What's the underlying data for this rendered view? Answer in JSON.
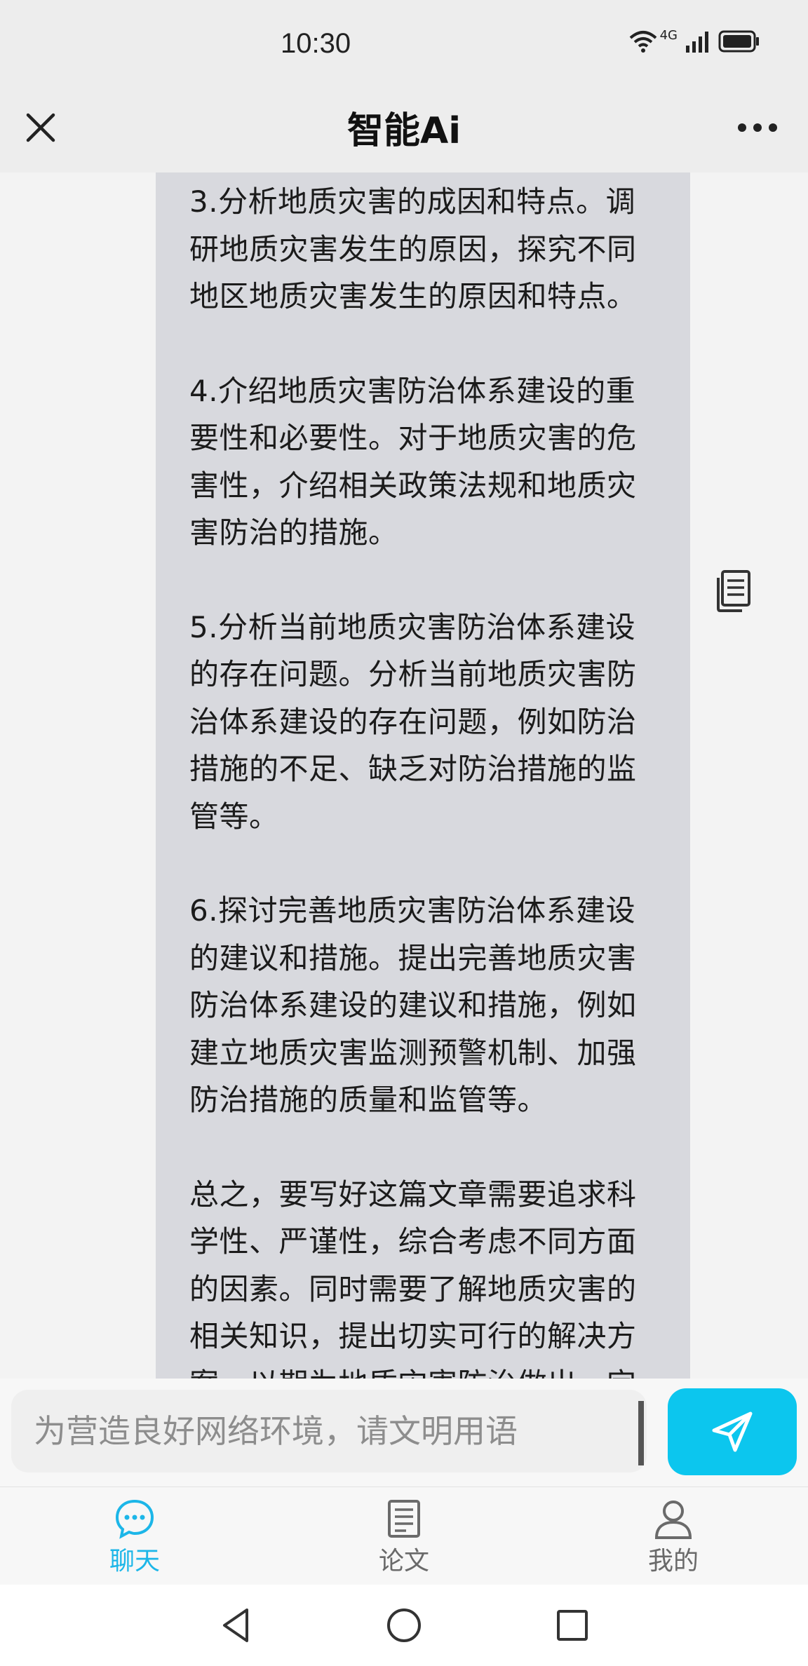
{
  "status_bar": {
    "time": "10:30",
    "network_label": "4G",
    "icons": [
      "wifi-icon",
      "signal-icon",
      "battery-icon"
    ]
  },
  "header": {
    "title": "智能Ai",
    "close_icon": "close-icon",
    "more_icon": "more-icon"
  },
  "chat": {
    "paragraphs": [
      "3.分析地质灾害的成因和特点。调研地质灾害发生的原因，探究不同地区地质灾害发生的原因和特点。",
      "4.介绍地质灾害防治体系建设的重要性和必要性。对于地质灾害的危害性，介绍相关政策法规和地质灾害防治的措施。",
      "5.分析当前地质灾害防治体系建设的存在问题。分析当前地质灾害防治体系建设的存在问题，例如防治措施的不足、缺乏对防治措施的监管等。",
      "6.探讨完善地质灾害防治体系建设的建议和措施。提出完善地质灾害防治体系建设的建议和措施，例如建立地质灾害监测预警机制、加强防治措施的质量和监管等。",
      "总之，要写好这篇文章需要追求科学性、严谨性，综合考虑不同方面的因素。同时需要了解地质灾害的相关知识，提出切实可行的解决方案，以期为地质灾害防治做出一定"
    ],
    "copy_icon": "copy-icon"
  },
  "input": {
    "placeholder": "为营造良好网络环境，请文明用语",
    "send_icon": "send-icon"
  },
  "bottom_nav": {
    "items": [
      {
        "label": "聊天",
        "icon": "chat-icon",
        "active": true
      },
      {
        "label": "论文",
        "icon": "paper-icon",
        "active": false
      },
      {
        "label": "我的",
        "icon": "profile-icon",
        "active": false
      }
    ]
  },
  "colors": {
    "accent": "#1cb6e8",
    "send_button": "#0cc6ee",
    "bubble": "#d8d9de"
  }
}
